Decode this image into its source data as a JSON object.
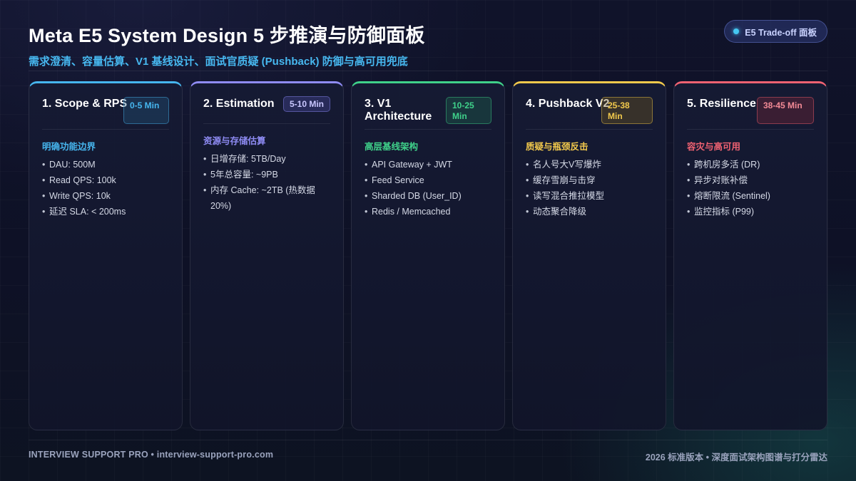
{
  "header": {
    "title": "Meta E5 System Design 5 步推演与防御面板",
    "subtitle": "需求澄清、容量估算、V1 基线设计、面试官质疑 (Pushback) 防御与高可用兜底",
    "badge": "E5 Trade-off 面板"
  },
  "cards": [
    {
      "title": "1. Scope & RPS",
      "time": "0-5 Min",
      "section": "明确功能边界",
      "accent": "#46b6ef",
      "items": [
        "DAU: 500M",
        "Read QPS: 100k",
        "Write QPS: 10k",
        "延迟 SLA: < 200ms"
      ]
    },
    {
      "title": "2. Estimation",
      "time": "5-10 Min",
      "section": "资源与存储估算",
      "accent": "#8f8cf5",
      "items": [
        "日增存储: 5TB/Day",
        "5年总容量: ~9PB",
        "内存 Cache: ~2TB (热数据 20%)"
      ]
    },
    {
      "title": "3. V1 Architecture",
      "time": "10-25 Min",
      "section": "高层基线架构",
      "accent": "#3fd18a",
      "items": [
        "API Gateway + JWT",
        "Feed Service",
        "Sharded DB (User_ID)",
        "Redis / Memcached"
      ]
    },
    {
      "title": "4. Pushback V2",
      "time": "25-38 Min",
      "section": "质疑与瓶颈反击",
      "accent": "#f2c94c",
      "items": [
        "名人号大V写爆炸",
        "缓存雪崩与击穿",
        "读写混合推拉模型",
        "动态聚合降级"
      ]
    },
    {
      "title": "5. Resilience",
      "time": "38-45 Min",
      "section": "容灾与高可用",
      "accent": "#f06272",
      "items": [
        "跨机房多活 (DR)",
        "异步对账补偿",
        "熔断限流 (Sentinel)",
        "监控指标 (P99)"
      ]
    }
  ],
  "footer": {
    "left": "INTERVIEW SUPPORT PRO • interview-support-pro.com",
    "right": "2026 标准版本 • 深度面试架构图谱与打分雷达"
  }
}
